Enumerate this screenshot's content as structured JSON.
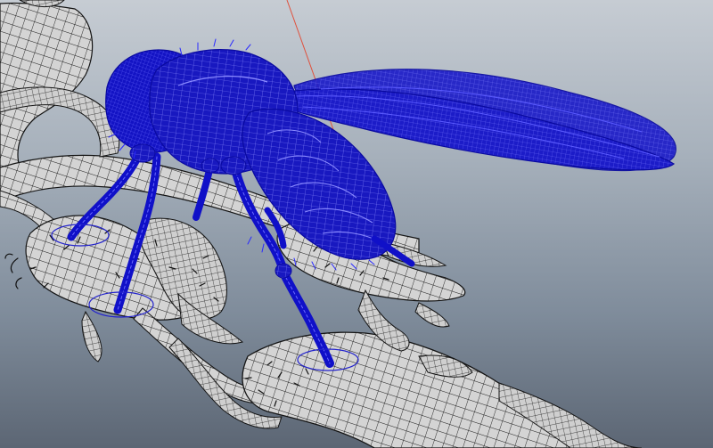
{
  "viewport": {
    "label": "",
    "background_top": "#c6ccd3",
    "background_bottom": "#5c6674"
  },
  "scene": {
    "selected_object_color": "#1010c8",
    "unselected_mesh_color": "#d2d2d2",
    "wire_color": "#141414",
    "manipulator_line_color": "#e0503c",
    "objects": [
      {
        "name": "insect-fly",
        "selected": true
      },
      {
        "name": "branch",
        "selected": false
      }
    ]
  }
}
